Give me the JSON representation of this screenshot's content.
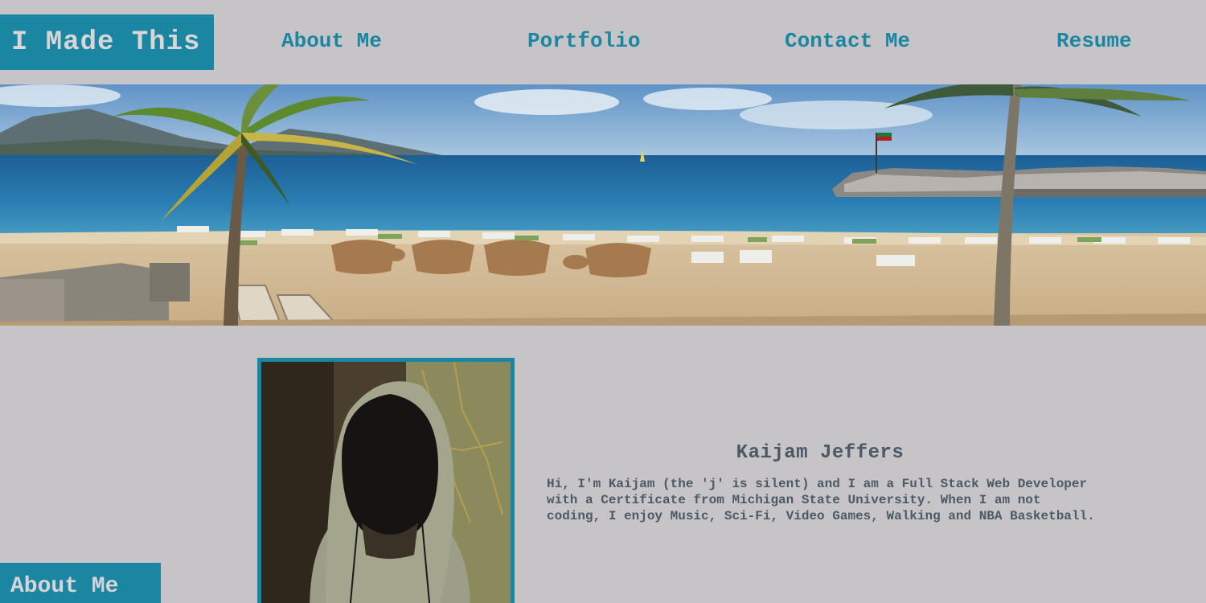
{
  "header": {
    "brand": "I Made This",
    "nav": [
      {
        "label": "About Me"
      },
      {
        "label": "Portfolio"
      },
      {
        "label": "Contact Me"
      },
      {
        "label": "Resume"
      }
    ]
  },
  "hero": {
    "image": "beach-with-palm-trees-and-lounge-chairs"
  },
  "about": {
    "photo": "person-in-grey-hoodie",
    "name": "Kaijam Jeffers",
    "bio": "Hi, I'm Kaijam (the 'j' is silent) and I am a Full Stack Web Developer with a Certificate from Michigan State University. When I am not coding, I enjoy Music, Sci-Fi, Video Games, Walking and NBA Basketball.",
    "section_label": "About Me"
  },
  "colors": {
    "accent": "#1a86a1",
    "background": "#c6c4c7",
    "text": "#4b5a66"
  }
}
